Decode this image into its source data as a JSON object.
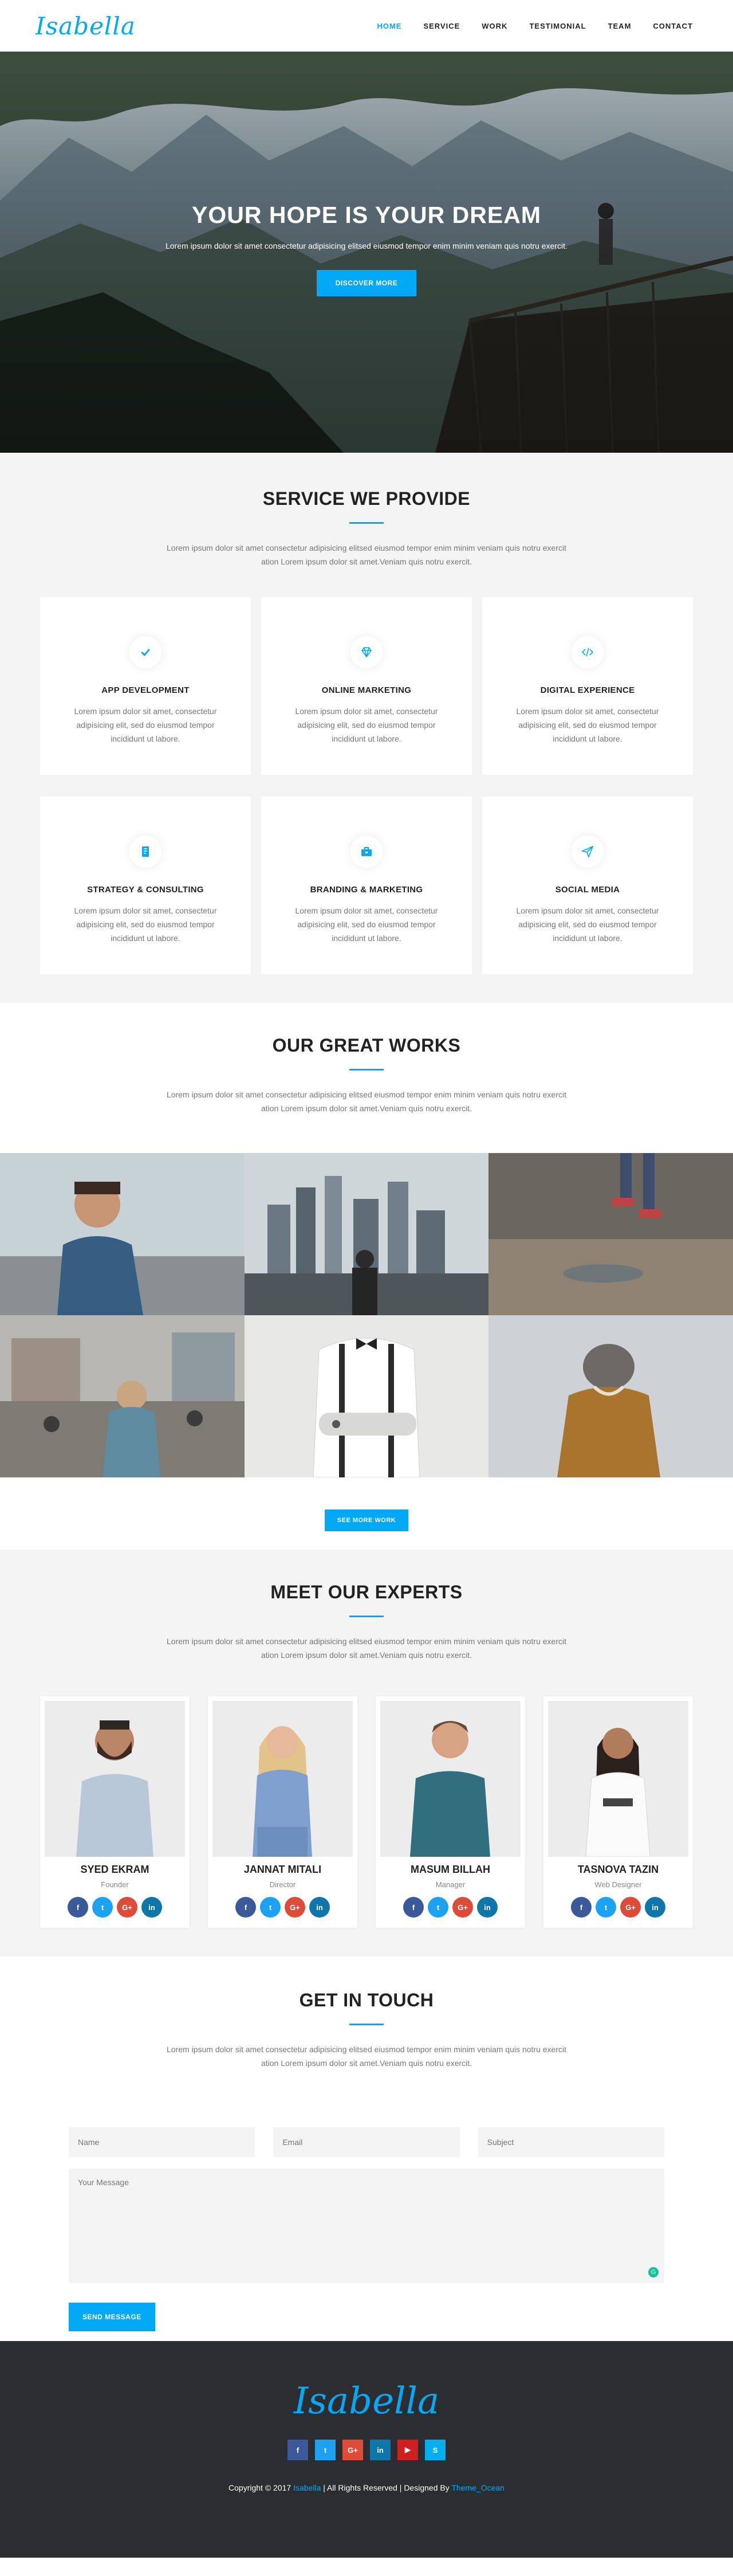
{
  "nav": {
    "logo": "Isabella",
    "items": [
      {
        "label": "HOME"
      },
      {
        "label": "SERVICE"
      },
      {
        "label": "WORK"
      },
      {
        "label": "TESTIMONIAL"
      },
      {
        "label": "TEAM"
      },
      {
        "label": "CONTACT"
      }
    ]
  },
  "hero": {
    "title": "YOUR HOPE IS YOUR DREAM",
    "text": "Lorem ipsum dolor sit amet consectetur adipisicing elitsed eiusmod tempor enim minim veniam quis notru exercit.",
    "button": "DISCOVER MORE"
  },
  "services": {
    "title": "SERVICE WE PROVIDE",
    "desc": "Lorem ipsum dolor sit amet consectetur adipisicing elitsed eiusmod tempor enim minim veniam quis notru exercit ation Lorem ipsum dolor sit amet.Veniam quis notru exercit.",
    "items": [
      {
        "title": "APP DEVELOPMENT",
        "text": "Lorem ipsum dolor sit amet, consectetur adipisicing elit, sed do eiusmod tempor incididunt ut labore.",
        "icon": "check-icon"
      },
      {
        "title": "ONLINE MARKETING",
        "text": "Lorem ipsum dolor sit amet, consectetur adipisicing elit, sed do eiusmod tempor incididunt ut labore.",
        "icon": "diamond-icon"
      },
      {
        "title": "DIGITAL EXPERIENCE",
        "text": "Lorem ipsum dolor sit amet, consectetur adipisicing elit, sed do eiusmod tempor incididunt ut labore.",
        "icon": "code-icon"
      },
      {
        "title": "STRATEGY & CONSULTING",
        "text": "Lorem ipsum dolor sit amet, consectetur adipisicing elit, sed do eiusmod tempor incididunt ut labore.",
        "icon": "bookmark-icon"
      },
      {
        "title": "BRANDING & MARKETING",
        "text": "Lorem ipsum dolor sit amet, consectetur adipisicing elit, sed do eiusmod tempor incididunt ut labore.",
        "icon": "briefcase-icon"
      },
      {
        "title": "SOCIAL MEDIA",
        "text": "Lorem ipsum dolor sit amet, consectetur adipisicing elit, sed do eiusmod tempor incididunt ut labore.",
        "icon": "paper-plane-icon"
      }
    ]
  },
  "works": {
    "title": "OUR GREAT WORKS",
    "desc": "Lorem ipsum dolor sit amet consectetur adipisicing elitsed eiusmod tempor enim minim veniam quis notru exercit ation Lorem ipsum dolor sit amet.Veniam quis notru exercit.",
    "button": "SEE MORE WORK"
  },
  "team": {
    "title": "MEET OUR EXPERTS",
    "desc": "Lorem ipsum dolor sit amet consectetur adipisicing elitsed eiusmod tempor enim minim veniam quis notru exercit ation Lorem ipsum dolor sit amet.Veniam quis notru exercit.",
    "members": [
      {
        "name": "SYED EKRAM",
        "role": "Founder"
      },
      {
        "name": "JANNAT MITALI",
        "role": "Director"
      },
      {
        "name": "MASUM BILLAH",
        "role": "Manager"
      },
      {
        "name": "TASNOVA TAZIN",
        "role": "Web Designer"
      }
    ],
    "social_colors": {
      "facebook": "#3b5998",
      "twitter": "#1da1f2",
      "google": "#dd4b39",
      "linkedin": "#0e76a8"
    }
  },
  "contact": {
    "title": "GET IN TOUCH",
    "desc": "Lorem ipsum dolor sit amet consectetur adipisicing elitsed eiusmod tempor enim minim veniam quis notru exercit ation Lorem ipsum dolor sit amet.Veniam quis notru exercit.",
    "name_placeholder": "Name",
    "email_placeholder": "Email",
    "subject_placeholder": "Subject",
    "message_placeholder": "Your Message",
    "button": "SEND MESSAGE"
  },
  "footer": {
    "logo": "Isabella",
    "copy_prefix": "Copyright © 2017",
    "brand": "Isabella",
    "copy_mid": "| All Rights Reserved | Designed By",
    "designer": "Theme_Ocean"
  },
  "colors": {
    "accent": "#03a9f4",
    "footer_bg": "#2c2d31",
    "section_gray": "#f4f4f4"
  }
}
